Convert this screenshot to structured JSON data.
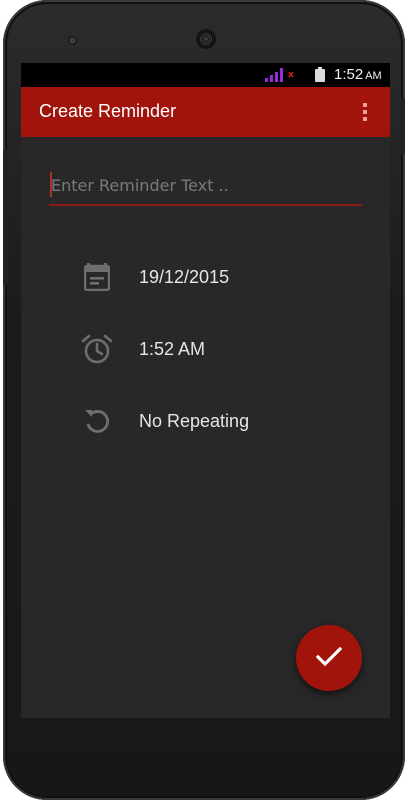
{
  "status_bar": {
    "time": "1:52",
    "ampm": "AM",
    "no_data_mark": "x"
  },
  "app_bar": {
    "title": "Create Reminder",
    "color": "#a0140c"
  },
  "reminder_input": {
    "value": "",
    "placeholder": "Enter Reminder Text .."
  },
  "options": {
    "date": {
      "icon": "calendar-icon",
      "label": "19/12/2015"
    },
    "time": {
      "icon": "alarm-clock-icon",
      "label": "1:52 AM"
    },
    "repeat": {
      "icon": "repeat-icon",
      "label": "No Repeating"
    }
  },
  "fab": {
    "icon": "check-icon"
  },
  "colors": {
    "accent": "#a0140c",
    "background": "#282828",
    "icon": "#6e6e6e",
    "signal": "#9b2bd8"
  }
}
